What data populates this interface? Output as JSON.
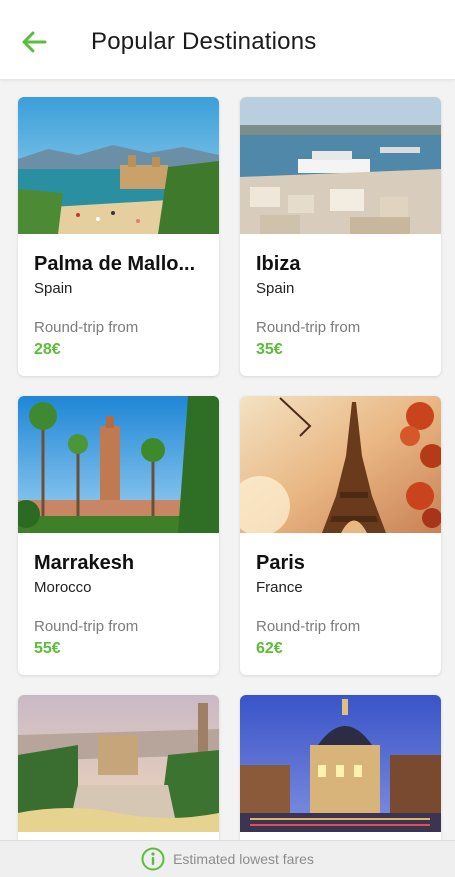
{
  "header": {
    "title": "Popular Destinations",
    "back_icon": "arrow-left-icon"
  },
  "colors": {
    "accent_green": "#5cbd3a",
    "header_bg": "#ffffff",
    "page_bg": "#f3f3f3"
  },
  "destinations": [
    {
      "city": "Palma de Mallo...",
      "country": "Spain",
      "round_trip_label": "Round-trip from",
      "price": "28€"
    },
    {
      "city": "Ibiza",
      "country": "Spain",
      "round_trip_label": "Round-trip from",
      "price": "35€"
    },
    {
      "city": "Marrakesh",
      "country": "Morocco",
      "round_trip_label": "Round-trip from",
      "price": "55€"
    },
    {
      "city": "Paris",
      "country": "France",
      "round_trip_label": "Round-trip from",
      "price": "62€"
    }
  ],
  "footer": {
    "text": "Estimated lowest fares",
    "icon": "info-icon"
  }
}
